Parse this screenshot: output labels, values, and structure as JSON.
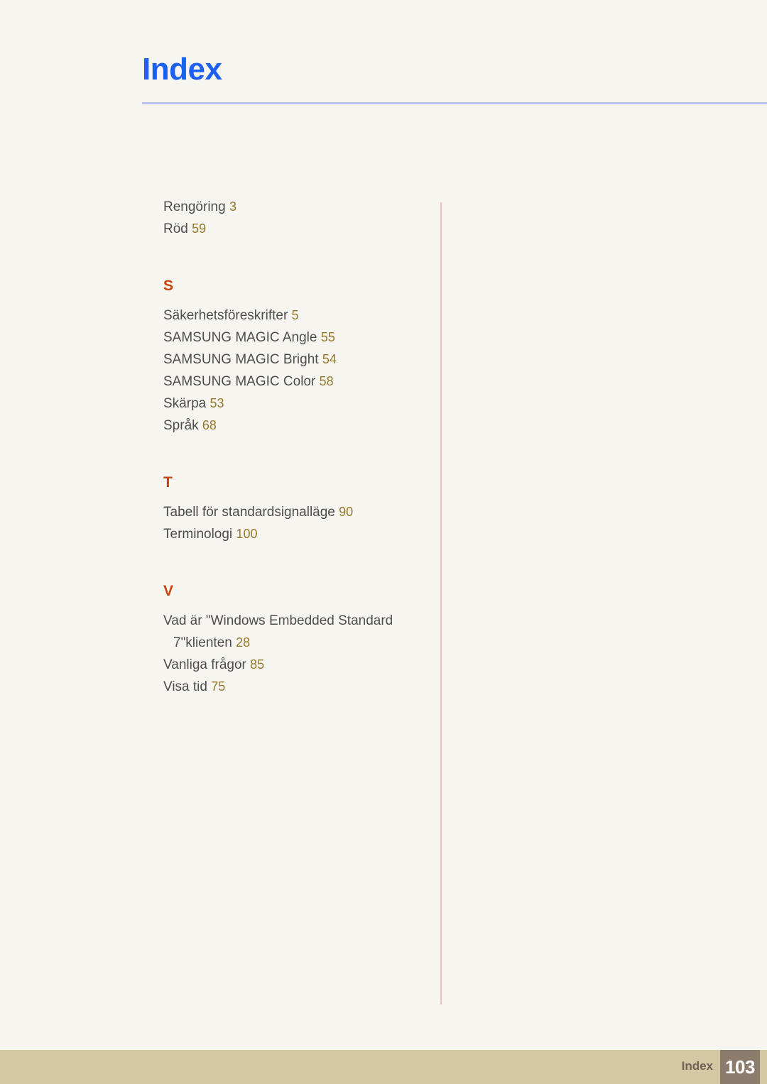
{
  "header": {
    "title": "Index"
  },
  "index": {
    "groups": [
      {
        "letter": "",
        "entries": [
          {
            "text": "Rengöring",
            "page": "3"
          },
          {
            "text": "Röd",
            "page": "59"
          }
        ]
      },
      {
        "letter": "S",
        "entries": [
          {
            "text": "Säkerhetsföreskrifter",
            "page": "5"
          },
          {
            "text": "SAMSUNG MAGIC Angle",
            "page": "55"
          },
          {
            "text": "SAMSUNG MAGIC Bright",
            "page": "54"
          },
          {
            "text": "SAMSUNG MAGIC Color",
            "page": "58"
          },
          {
            "text": "Skärpa",
            "page": "53"
          },
          {
            "text": "Språk",
            "page": "68"
          }
        ]
      },
      {
        "letter": "T",
        "entries": [
          {
            "text": "Tabell för standardsignalläge",
            "page": "90"
          },
          {
            "text": "Terminologi",
            "page": "100"
          }
        ]
      },
      {
        "letter": "V",
        "entries": [
          {
            "text": "Vad är \"Windows Embedded Standard",
            "continuation": "7\"klienten",
            "page": "28"
          },
          {
            "text": "Vanliga frågor",
            "page": "85"
          },
          {
            "text": "Visa tid",
            "page": "75"
          }
        ]
      }
    ]
  },
  "footer": {
    "label": "Index",
    "page_number": "103"
  },
  "colors": {
    "page_background": "#f6f5ef",
    "title_blue": "#1c60f0",
    "header_rule": "#b9bdf2",
    "group_letter_orange": "#c4460d",
    "entry_text": "#4e4e4e",
    "page_number_gold": "#96792d",
    "column_divider": "#e8c3c3",
    "footer_band": "#d5c6a4",
    "footer_label": "#6e6257",
    "footer_box": "#8b7c6d"
  }
}
